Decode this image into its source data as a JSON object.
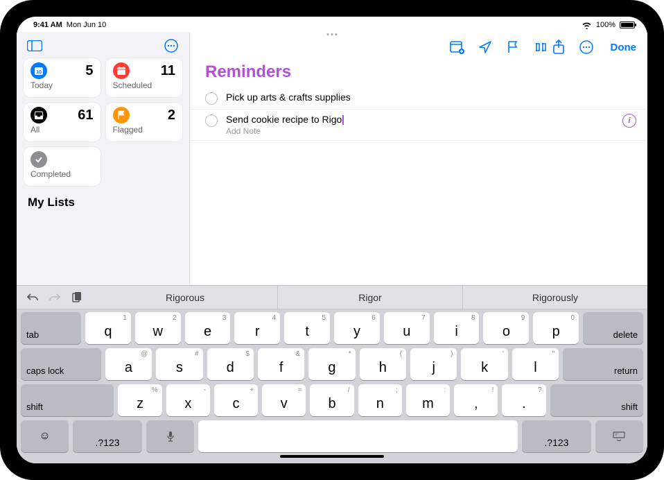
{
  "statusbar": {
    "time": "9:41 AM",
    "date": "Mon Jun 10",
    "battery": "100%"
  },
  "sidebar": {
    "smart": {
      "today": {
        "label": "Today",
        "count": "5",
        "color": "#007aff"
      },
      "scheduled": {
        "label": "Scheduled",
        "count": "11",
        "color": "#ff3b30"
      },
      "all": {
        "label": "All",
        "count": "61",
        "color": "#000000"
      },
      "flagged": {
        "label": "Flagged",
        "count": "2",
        "color": "#ff9500"
      },
      "completed": {
        "label": "Completed"
      }
    },
    "mylists_heading": "My Lists"
  },
  "main": {
    "title": "Reminders",
    "title_color": "#b050d6",
    "done": "Done",
    "reminders": [
      {
        "title": "Pick up arts & crafts supplies"
      },
      {
        "title": "Send cookie recipe to Rigo",
        "note_placeholder": "Add Note",
        "editing": true
      }
    ]
  },
  "keyboard": {
    "suggestions": [
      "Rigorous",
      "Rigor",
      "Rigorously"
    ],
    "row1": [
      {
        "k": "q",
        "s": "1"
      },
      {
        "k": "w",
        "s": "2"
      },
      {
        "k": "e",
        "s": "3"
      },
      {
        "k": "r",
        "s": "4"
      },
      {
        "k": "t",
        "s": "5"
      },
      {
        "k": "u",
        "s": "7"
      },
      {
        "k": "i",
        "s": "8"
      },
      {
        "k": "o",
        "s": "9"
      },
      {
        "k": "p",
        "s": "0"
      }
    ],
    "row1_y": {
      "k": "y",
      "s": "6"
    },
    "row2": [
      {
        "k": "a",
        "s": "@"
      },
      {
        "k": "s",
        "s": "#"
      },
      {
        "k": "d",
        "s": "$"
      },
      {
        "k": "f",
        "s": "&"
      },
      {
        "k": "g",
        "s": "*"
      },
      {
        "k": "h",
        "s": "("
      },
      {
        "k": "j",
        "s": ")"
      },
      {
        "k": "k",
        "s": "'"
      },
      {
        "k": "l",
        "s": "\""
      }
    ],
    "row3": [
      {
        "k": "z",
        "s": "%"
      },
      {
        "k": "x",
        "s": "-"
      },
      {
        "k": "c",
        "s": "+"
      },
      {
        "k": "v",
        "s": "="
      },
      {
        "k": "b",
        "s": "/"
      },
      {
        "k": "n",
        "s": ";"
      },
      {
        "k": "m",
        "s": ":"
      },
      {
        "k": ",",
        "s": "!"
      },
      {
        "k": ".",
        "s": "?"
      }
    ],
    "tab": "tab",
    "delete": "delete",
    "caps": "caps lock",
    "ret": "return",
    "shift": "shift",
    "numswitch": ".?123"
  }
}
